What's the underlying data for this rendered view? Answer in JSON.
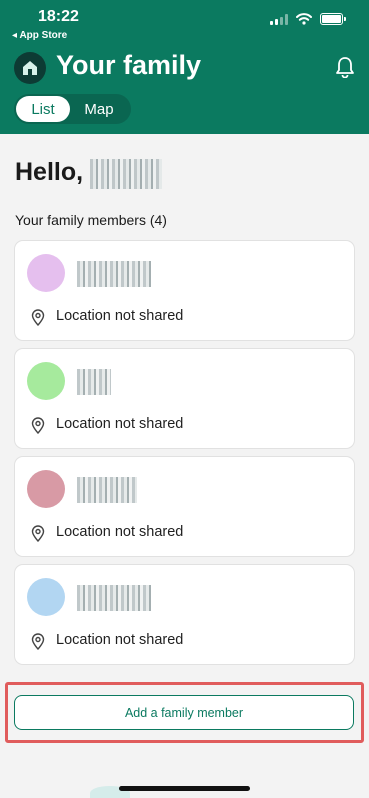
{
  "status": {
    "time": "18:22",
    "back_label": "App Store"
  },
  "header": {
    "title": "Your family",
    "tabs": {
      "list": "List",
      "map": "Map"
    }
  },
  "greeting": {
    "text": "Hello,"
  },
  "family": {
    "section_label": "Your family members (4)",
    "members": [
      {
        "avatar_color": "#e5bfee",
        "location": "Location not shared"
      },
      {
        "avatar_color": "#a6ea9d",
        "location": "Location not shared"
      },
      {
        "avatar_color": "#d89aa5",
        "location": "Location not shared"
      },
      {
        "avatar_color": "#b2d6f2",
        "location": "Location not shared"
      }
    ]
  },
  "actions": {
    "add_member": "Add a family member"
  },
  "colors": {
    "brand": "#0b7a60",
    "highlight": "#e05c5c"
  }
}
